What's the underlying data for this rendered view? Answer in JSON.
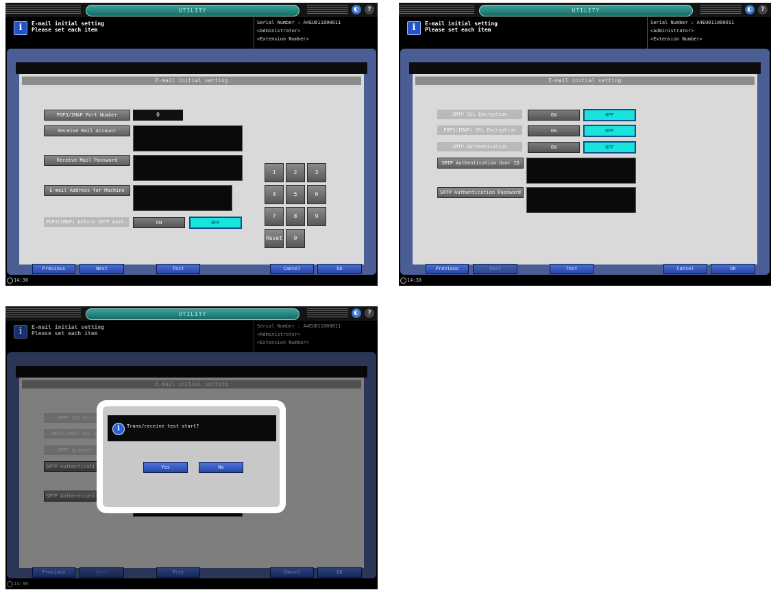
{
  "utility_label": "UTILITY",
  "header": {
    "info_icon": "info-icon",
    "title": "E-mail initial setting",
    "subtitle": "Please set each item",
    "serial_label": "Serial Number",
    "serial_value": ": A4EU011000011",
    "admin": "<Administrator>",
    "extension": "<Extension Number>"
  },
  "section_title": "E-mail initial setting",
  "time": "14:30",
  "footer": {
    "previous": "Previous",
    "next": "Next",
    "test": "Test",
    "cancel": "Cancel",
    "ok": "OK"
  },
  "screen1": {
    "pop3_port_label": "POP3/IMAP Port Number",
    "pop3_port_value": "0",
    "receive_account_label": "Receive Mail Account",
    "receive_password_label": "Receive Mail Password",
    "email_address_label": "E-mail Address for Machine",
    "pop_before_smtp_label": "POP3(IMAP) before SMTP Auth.",
    "on": "ON",
    "off": "OFF",
    "keypad": [
      "1",
      "2",
      "3",
      "4",
      "5",
      "6",
      "7",
      "8",
      "9",
      "Reset",
      "0"
    ]
  },
  "screen2": {
    "smtp_ssl_label": "SMTP SSL Encryption",
    "pop_ssl_label": "POP3(IMAP) SSL Encryption",
    "smtp_auth_label": "SMTP Authentication",
    "smtp_user_label": "SMTP Authentication User ID",
    "smtp_pass_label": "SMTP Authentication Password",
    "on": "ON",
    "off": "OFF"
  },
  "screen3": {
    "bg_label_1": "SMTP SSL Encr",
    "bg_label_2": "POP3(IMAP) SSL E",
    "bg_label_3": "SMTP Authent",
    "bg_label_4": "SMTP Authenticati",
    "bg_label_5": "SMTP Authenticati",
    "dialog_message": "Trans/receive test start?",
    "yes": "Yes",
    "no": "No"
  }
}
